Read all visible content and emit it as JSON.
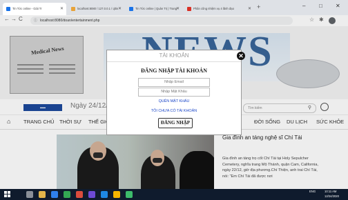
{
  "browser": {
    "tabs": [
      {
        "title": "Tin Tức online - Giải Tr",
        "favicon_color": "#1a73e8",
        "active": true
      },
      {
        "title": "localhost:8080 / 127.0.0.1 / qltin",
        "favicon_color": "#e8a33a",
        "active": false
      },
      {
        "title": "Tin Tức online | Quản Trị | Trang",
        "favicon_color": "#1a73e8",
        "active": false
      },
      {
        "title": "Phân công nhiệm vụ 4 lãnh đạo",
        "favicon_color": "#d93025",
        "active": false
      }
    ],
    "new_tab": "+",
    "window_controls": [
      "–",
      "□",
      "✕"
    ],
    "address": "localhost:8080/doan/entertainment.php",
    "nav": [
      "←",
      "→",
      "C",
      "⌂"
    ],
    "right_icons": [
      "☆",
      "✱"
    ]
  },
  "header": {
    "banner_word": "NEWS",
    "newspaper_headline": "Medical News",
    "date": "Ngày 24/12/2020",
    "search_placeholder": "Tìm kiếm",
    "search_icon": "search-icon",
    "user_icon": "user-icon"
  },
  "nav": {
    "home_icon": "home-icon",
    "items": [
      "TRANG CHỦ",
      "THỜI SỰ",
      "THẾ GIỚI",
      "ĐỜI SỐNG",
      "DU LỊCH",
      "SỨC KHỎE"
    ]
  },
  "article": {
    "title": "Gia đình an táng nghệ sĩ Chí Tài",
    "body": "Gia đình an táng trọ cốt Chí Tài tại Holy Sepulcher Cemetery, nghĩa trang Mộ Thánh, quận Cam, California, ngày 22/12, giờ địa phương.Chí Thiện, anh trai Chí Tài, nói: \"Em Chí Tài đã được nơi"
  },
  "modal": {
    "header": "TÀI KHOẢN",
    "title": "ĐĂNG NHẬP TÀI KHOẢN",
    "email_placeholder": "Nhập Email",
    "password_placeholder": "Nhập Mật Khẩu",
    "forgot_link": "QUÊN MẬT KHẨU",
    "no_account_link": "TÔI CHƯA CÓ TÀI KHOẢN",
    "login_button": "ĐĂNG NHẬP",
    "close": "✕"
  },
  "taskbar": {
    "tray_time": "10:11 AM",
    "tray_date": "12/24/2020",
    "tray_lang": "ENG"
  }
}
